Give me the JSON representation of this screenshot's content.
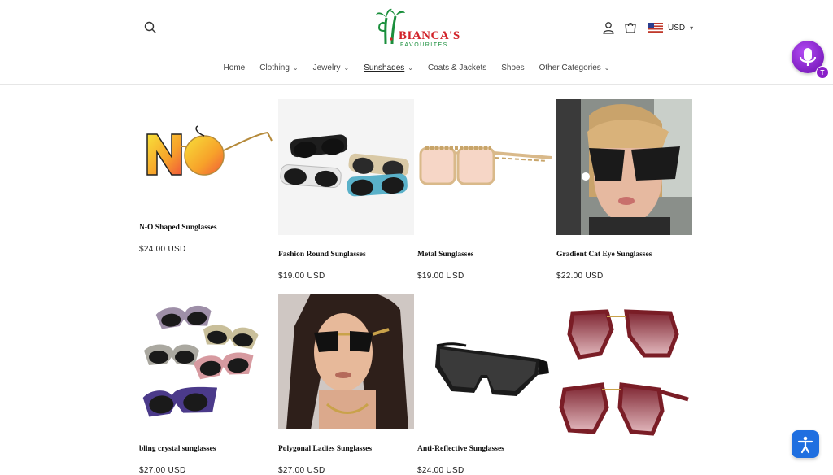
{
  "header": {
    "logo_name": "BIANCA'S",
    "logo_sub": "FAVOURITES",
    "currency": "USD",
    "search_icon": "search-icon",
    "account_icon": "user-icon",
    "cart_icon": "cart-icon"
  },
  "nav": {
    "items": [
      {
        "label": "Home",
        "dropdown": false
      },
      {
        "label": "Clothing",
        "dropdown": true
      },
      {
        "label": "Jewelry",
        "dropdown": true
      },
      {
        "label": "Sunshades",
        "dropdown": true,
        "active": true
      },
      {
        "label": "Coats & Jackets",
        "dropdown": false
      },
      {
        "label": "Shoes",
        "dropdown": false
      },
      {
        "label": "Other Categories",
        "dropdown": true
      }
    ]
  },
  "products": [
    {
      "title": "N-O Shaped Sunglasses",
      "price": "$24.00 USD"
    },
    {
      "title": "Fashion Round Sunglasses",
      "price": "$19.00 USD"
    },
    {
      "title": "Metal Sunglasses",
      "price": "$19.00 USD"
    },
    {
      "title": "Gradient Cat Eye Sunglasses",
      "price": "$22.00 USD"
    },
    {
      "title": "bling crystal sunglasses",
      "price": "$27.00 USD"
    },
    {
      "title": "Polygonal Ladies Sunglasses",
      "price": "$27.00 USD"
    },
    {
      "title": "Anti-Reflective Sunglasses",
      "price": "$24.00 USD"
    },
    {
      "title": "",
      "price": ""
    }
  ],
  "widgets": {
    "voice_badge": "T",
    "voice_icon": "microphone-icon",
    "accessibility_icon": "accessibility-icon"
  },
  "colors": {
    "brand_red": "#d2232a",
    "brand_green": "#1a8f3c",
    "voice_purple": "#8a1fc9",
    "a11y_blue": "#1f6fe0"
  }
}
